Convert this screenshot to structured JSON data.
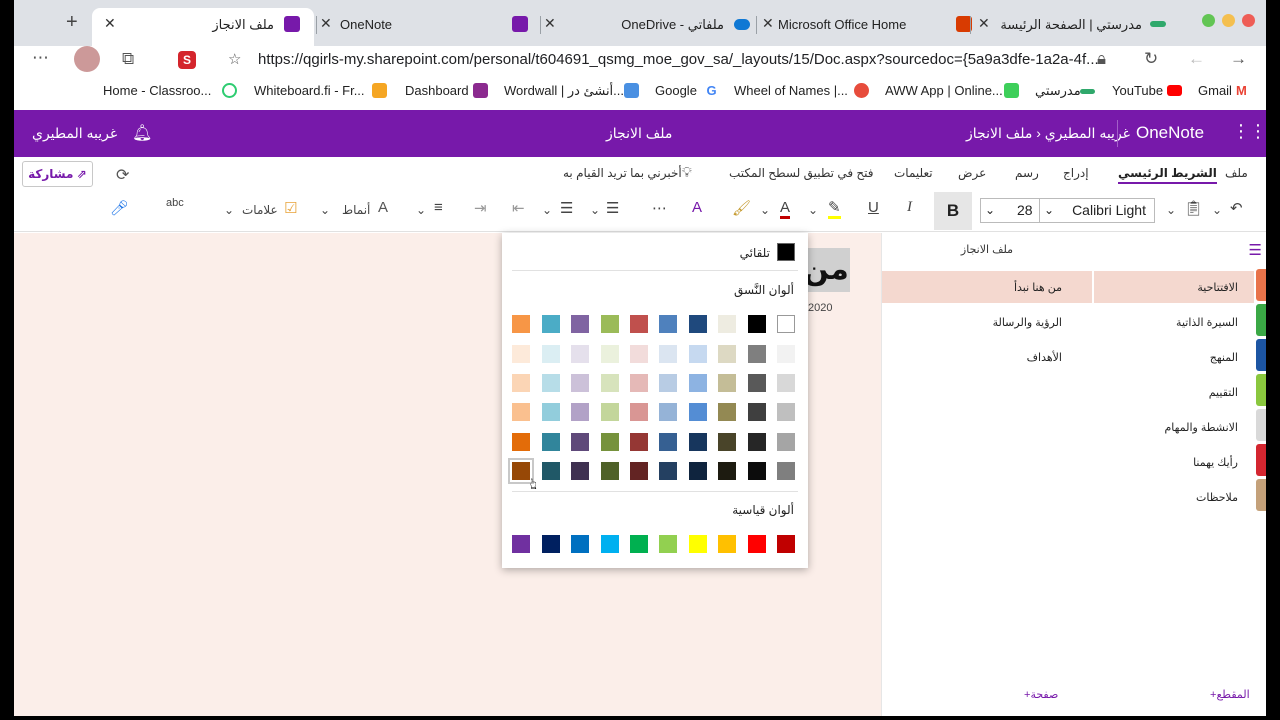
{
  "browser": {
    "tabs": [
      {
        "title": "مدرستي | الصفحة الرئيسة"
      },
      {
        "title": "Microsoft Office Home"
      },
      {
        "title": "OneDrive - ملفاتي"
      },
      {
        "title": "OneNote"
      },
      {
        "title": "ملف الانجاز"
      }
    ],
    "new_tab": "+",
    "url": "https://qgirls-my.sharepoint.com/personal/t604691_qsmg_moe_gov_sa/_layouts/15/Doc.aspx?sourcedoc={5a9a3dfe-1a2a-4f...",
    "bookmarks": [
      "Home - Classroo...",
      "Whiteboard.fi - Fr...",
      "Dashboard",
      "Wordwall | أنشئ در...",
      "Google",
      "Wheel of Names |...",
      "AWW App | Online...",
      "مدرستي",
      "YouTube",
      "Gmail"
    ]
  },
  "onenote": {
    "app_name": "OneNote",
    "breadcrumb": "غريبه المطيري ‹ ملف الانجاز",
    "doc_title": "ملف الانجاز",
    "user_name": "غريبه المطيري",
    "ribbon_tabs": [
      "ملف",
      "الشريط الرئيسي",
      "إدراج",
      "رسم",
      "عرض",
      "تعليمات",
      "فتح في تطبيق لسطح المكتب"
    ],
    "tell_me": "أخبرني بما تريد القيام به",
    "share_label": "مشاركة",
    "font_name": "Calibri Light",
    "font_size": "28",
    "bold_label": "B",
    "italic_label": "I",
    "underline_label": "U",
    "styles_label": "أنماط",
    "tags_label": "علامات",
    "spell_label": "abc"
  },
  "picker": {
    "automatic_label": "تلقائي",
    "theme_colors_label": "ألوان النَّسق",
    "standard_colors_label": "ألوان قياسية",
    "theme_rows": [
      [
        "#ffffff",
        "#000000",
        "#eeece1",
        "#1f497d",
        "#4f81bd",
        "#c0504d",
        "#9bbb59",
        "#8064a2",
        "#4bacc6",
        "#f79646"
      ],
      [
        "#f2f2f2",
        "#7f7f7f",
        "#ddd9c3",
        "#c6d9f0",
        "#dbe5f1",
        "#f2dcdb",
        "#ebf1dd",
        "#e5e0ec",
        "#dbeef3",
        "#fdeada"
      ],
      [
        "#d8d8d8",
        "#595959",
        "#c4bd97",
        "#8db3e2",
        "#b8cce4",
        "#e5b9b7",
        "#d7e3bc",
        "#ccc1d9",
        "#b7dde8",
        "#fbd5b5"
      ],
      [
        "#bfbfbf",
        "#3f3f3f",
        "#938953",
        "#548dd4",
        "#95b3d7",
        "#d99694",
        "#c3d69b",
        "#b2a2c7",
        "#92cddc",
        "#fac08f"
      ],
      [
        "#a5a5a5",
        "#262626",
        "#494429",
        "#17365d",
        "#366092",
        "#953734",
        "#76923c",
        "#5f497a",
        "#31859b",
        "#e36c09"
      ],
      [
        "#7f7f7f",
        "#0c0c0c",
        "#1d1b10",
        "#0f243e",
        "#244061",
        "#632423",
        "#4f6128",
        "#3f3151",
        "#205867",
        "#974806"
      ]
    ],
    "standard_row": [
      "#c00000",
      "#ff0000",
      "#ffc000",
      "#ffff00",
      "#92d050",
      "#00b050",
      "#00b0f0",
      "#0070c0",
      "#002060",
      "#7030a0"
    ]
  },
  "page": {
    "heading_fragment": "من",
    "date_fragment": "2020"
  },
  "pages_panel": {
    "title": "ملف الانجاز",
    "pages": [
      "من هنا نبدأ",
      "الرؤية والرسالة",
      "الأهداف"
    ],
    "add_page": "+صفحة"
  },
  "sections_panel": {
    "sections": [
      {
        "name": "الافتتاحية",
        "color": "#e8734a"
      },
      {
        "name": "السيرة الذاتية",
        "color": "#3aa845"
      },
      {
        "name": "المنهج",
        "color": "#1c55a3"
      },
      {
        "name": "التقييم",
        "color": "#8ac73e"
      },
      {
        "name": "الانشطة والمهام",
        "color": "#d9d9d9"
      },
      {
        "name": "رأيك يهمنا",
        "color": "#d42630"
      },
      {
        "name": "ملاحظات",
        "color": "#c4a17a"
      }
    ],
    "add_section": "+المقطع"
  }
}
